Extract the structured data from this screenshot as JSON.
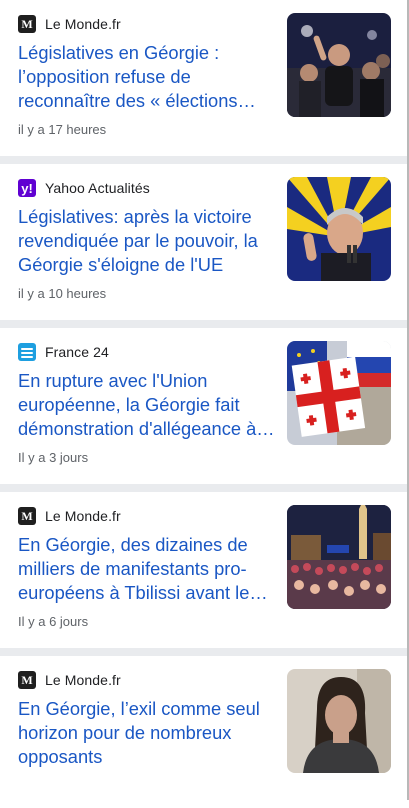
{
  "articles": [
    {
      "source": "Le Monde.fr",
      "logo_icon": "lemonde-logo-icon",
      "headline": "Législatives en Géorgie : l’opposition refuse de reconnaître des « élections truquées »",
      "time": "il y a 17 heures"
    },
    {
      "source": "Yahoo Actualités",
      "logo_icon": "yahoo-logo-icon",
      "headline": "Législatives: après la victoire revendiquée par le pouvoir, la Géorgie s'éloigne de l'UE",
      "time": "il y a 10 heures"
    },
    {
      "source": "France 24",
      "logo_icon": "france24-logo-icon",
      "headline": "En rupture avec l'Union européenne, la Géorgie fait démonstration d'allégeance à Moscou",
      "time": "Il y a 3 jours"
    },
    {
      "source": "Le Monde.fr",
      "logo_icon": "lemonde-logo-icon",
      "headline": "En Géorgie, des dizaines de milliers de manifestants pro-européens à Tbilissi avant les élections",
      "time": "Il y a 6 jours"
    },
    {
      "source": "Le Monde.fr",
      "logo_icon": "lemonde-logo-icon",
      "headline": "En Géorgie, l’exil comme seul horizon pour de nombreux opposants",
      "time": ""
    }
  ],
  "logo_glyphs": {
    "lemonde": "M",
    "yahoo": "y!"
  },
  "colors": {
    "headline": "#1a57c4",
    "separator": "#e9ebee",
    "meta": "#5f6368"
  }
}
